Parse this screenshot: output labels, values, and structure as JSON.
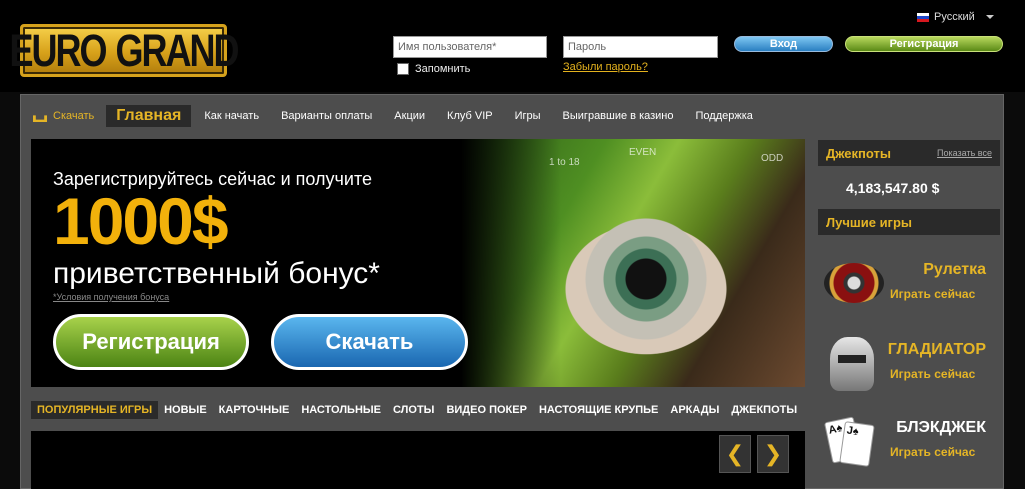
{
  "header": {
    "logo_left": "EURO",
    "logo_right": "GRAND",
    "language": "Русский",
    "username_placeholder": "Имя пользователя*",
    "password_placeholder": "Пароль",
    "remember_label": "Запомнить",
    "forgot_label": "Забыли пароль?",
    "login_label": "Вход",
    "register_label": "Регистрация"
  },
  "nav": {
    "download": "Скачать",
    "home": "Главная",
    "items": [
      "Как начать",
      "Варианты оплаты",
      "Акции",
      "Клуб VIP",
      "Игры",
      "Выигравшие в казино",
      "Поддержка"
    ]
  },
  "banner": {
    "line1": "Зарегистрируйтесь сейчас и получите",
    "amount": "1000$",
    "line2": "приветственный бонус*",
    "terms": "*Условия получения бонуса",
    "register_button": "Регистрация",
    "download_button": "Скачать",
    "wheel_numbers": [
      "1 to 18",
      "EVEN",
      "ODD"
    ]
  },
  "game_tabs": [
    "ПОПУЛЯРНЫЕ ИГРЫ",
    "НОВЫЕ",
    "КАРТОЧНЫЕ",
    "НАСТОЛЬНЫЕ",
    "СЛОТЫ",
    "ВИДЕО ПОКЕР",
    "НАСТОЯЩИЕ КРУПЬЕ",
    "АРКАДЫ",
    "ДЖЕКПОТЫ"
  ],
  "carousel": {
    "prev": "❮",
    "next": "❯"
  },
  "sidebar": {
    "jackpots_title": "Джекпоты",
    "show_all": "Показать все",
    "jackpot_value": "4,183,547.80 $",
    "best_games_title": "Лучшие игры",
    "games": [
      {
        "name": "Рулетка",
        "play": "Играть сейчас"
      },
      {
        "name": "ГЛАДИАТОР",
        "play": "Играть сейчас"
      },
      {
        "name": "БЛЭКДЖЕК",
        "play": "Играть сейчас"
      }
    ],
    "cards": [
      "A♠",
      "J♠"
    ]
  },
  "colors": {
    "accent": "#e5b526",
    "green": "#7fb22a",
    "blue": "#2a7fc1",
    "panel": "#4d4d4d"
  }
}
